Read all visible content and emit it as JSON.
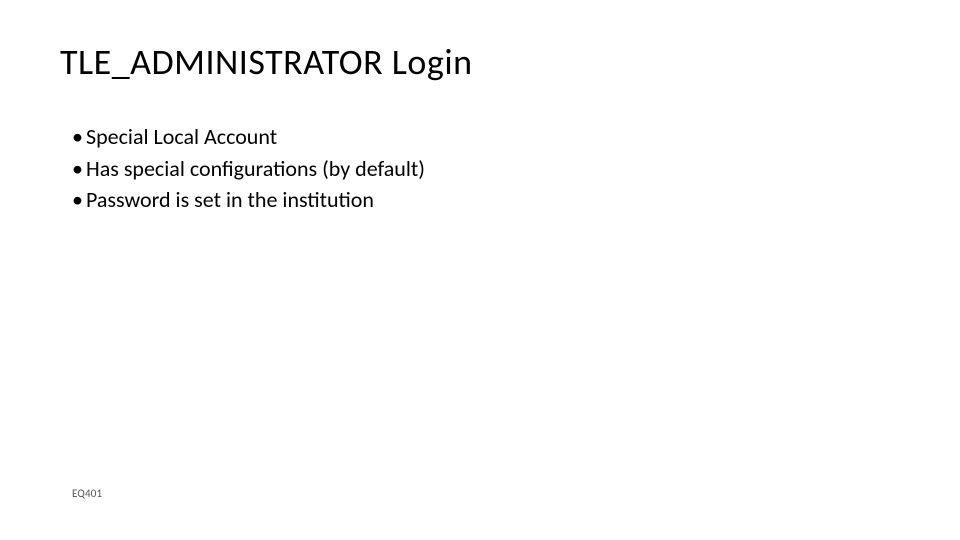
{
  "title": "TLE_ADMINISTRATOR Login",
  "bullets": [
    "Special Local Account",
    "Has special configurations (by default)",
    "Password is set in the institution"
  ],
  "footer": "EQ401"
}
